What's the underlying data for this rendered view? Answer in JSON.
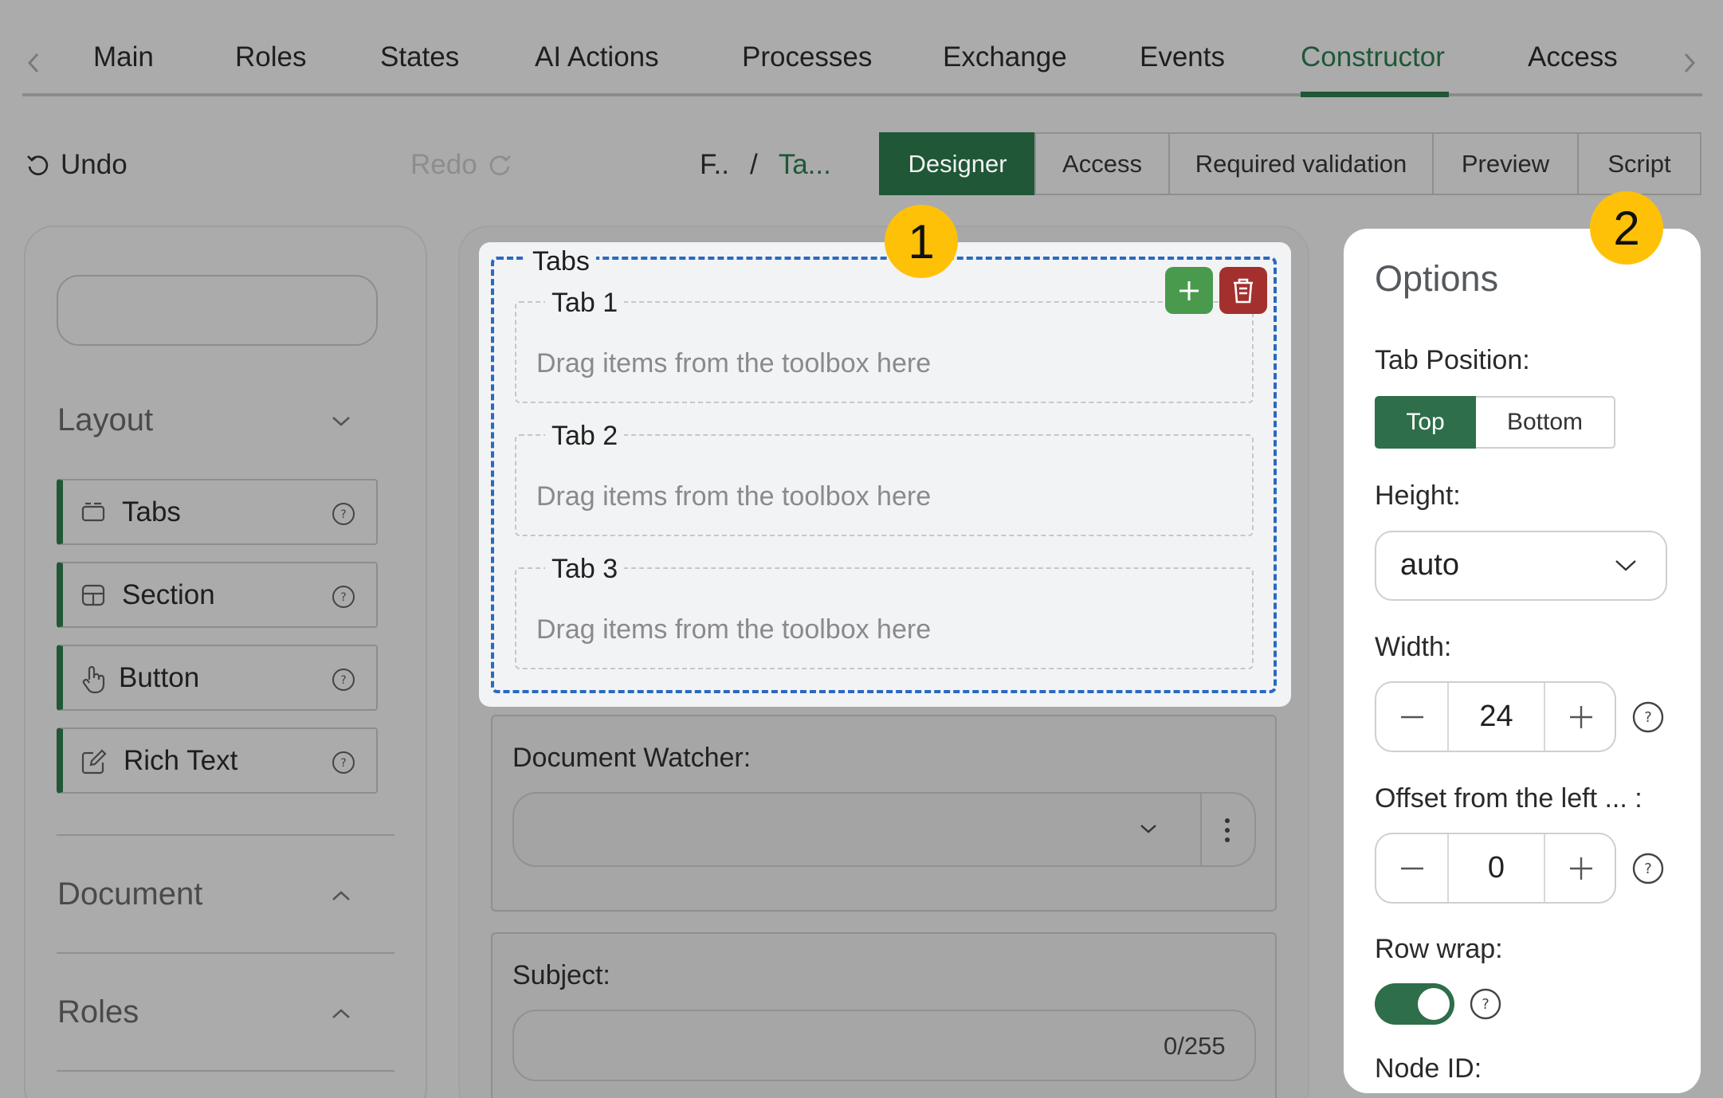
{
  "nav": {
    "tabs": [
      "Main",
      "Roles",
      "States",
      "AI Actions",
      "Processes",
      "Exchange",
      "Events",
      "Constructor",
      "Access"
    ],
    "active": "Constructor"
  },
  "toolbar": {
    "undo": "Undo",
    "redo": "Redo",
    "breadcrumb": {
      "first": "F..",
      "separator": "/",
      "second": "Ta..."
    },
    "modes": [
      "Designer",
      "Access",
      "Required validation",
      "Preview",
      "Script"
    ],
    "active_mode": "Designer"
  },
  "toolbox": {
    "search_value": "",
    "layout_title": "Layout",
    "items": [
      {
        "label": "Tabs",
        "icon": "tabs-icon"
      },
      {
        "label": "Section",
        "icon": "section-icon"
      },
      {
        "label": "Button",
        "icon": "hand-pointer-icon"
      },
      {
        "label": "Rich Text",
        "icon": "edit-icon"
      }
    ],
    "document_title": "Document",
    "roles_title": "Roles"
  },
  "canvas": {
    "tabs_component": {
      "label": "Tabs",
      "tabs": [
        {
          "title": "Tab 1",
          "hint": "Drag items from the toolbox here"
        },
        {
          "title": "Tab 2",
          "hint": "Drag items from the toolbox here"
        },
        {
          "title": "Tab 3",
          "hint": "Drag items from the toolbox here"
        }
      ]
    },
    "document_watcher": {
      "label": "Document Watcher:",
      "value": ""
    },
    "subject": {
      "label": "Subject:",
      "counter": "0/255"
    }
  },
  "options": {
    "title": "Options",
    "tab_position": {
      "label": "Tab Position:",
      "options": [
        "Top",
        "Bottom"
      ],
      "selected": "Top"
    },
    "height": {
      "label": "Height:",
      "value": "auto"
    },
    "width": {
      "label": "Width:",
      "value": "24"
    },
    "offset": {
      "label": "Offset from the left ... :",
      "value": "0"
    },
    "row_wrap": {
      "label": "Row wrap:",
      "enabled": true
    },
    "node_id": {
      "label": "Node ID:"
    }
  },
  "badges": [
    "1",
    "2"
  ],
  "colors": {
    "accent": "#1f5737",
    "accent_light": "#2e6e4a",
    "add": "#4a9a4d",
    "delete": "#a4302d",
    "dashed_border": "#2a69c0",
    "badge": "#ffc107"
  }
}
